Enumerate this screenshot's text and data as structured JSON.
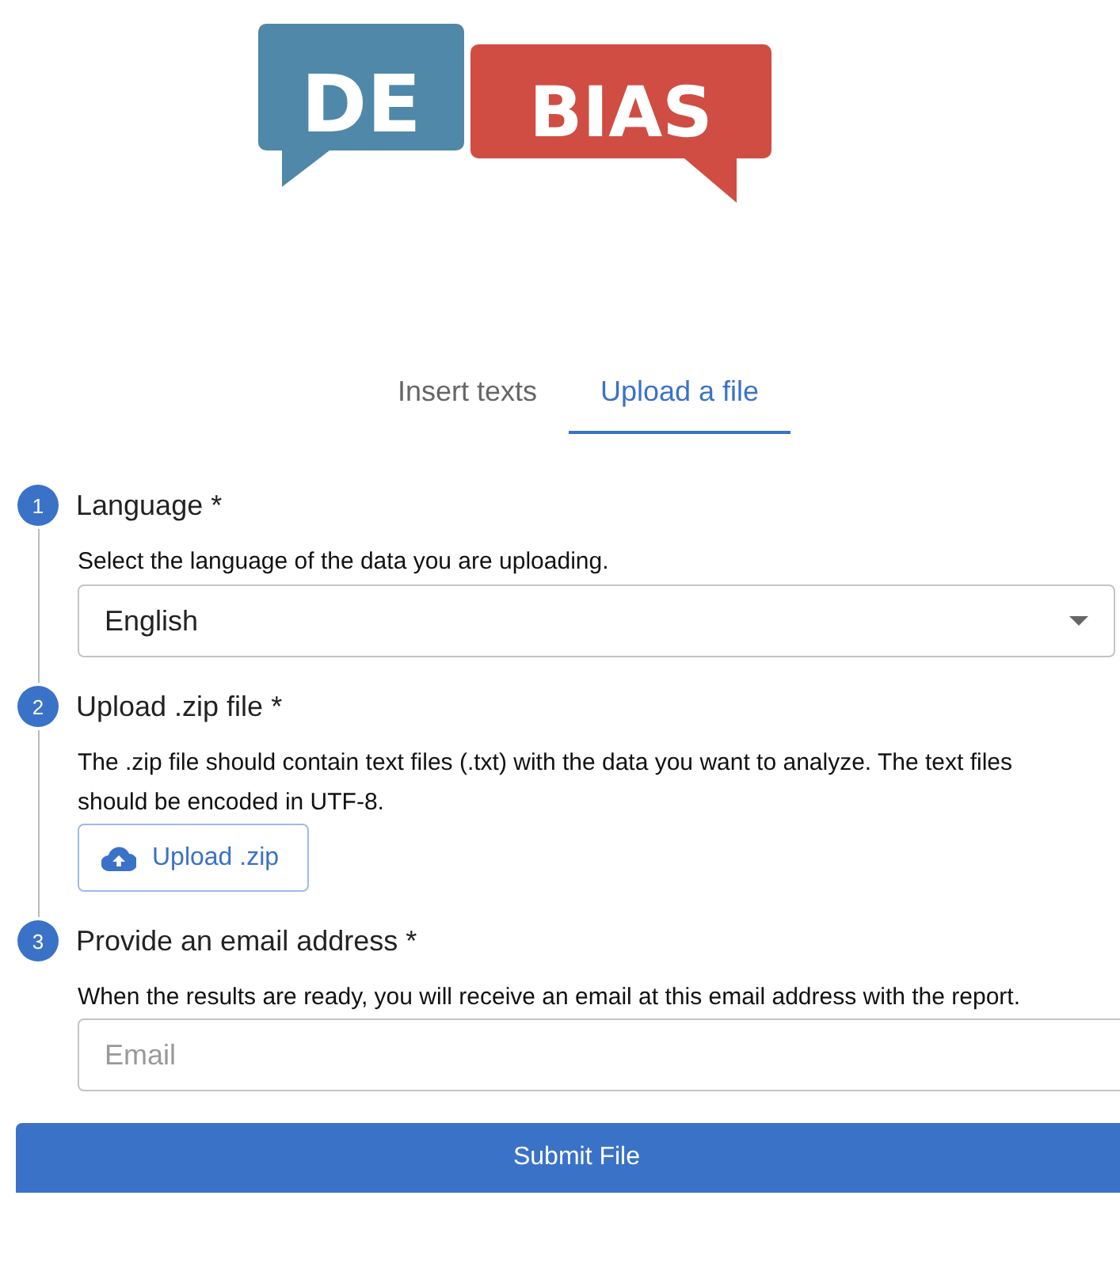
{
  "logo": {
    "words": [
      "DE",
      "BIAS"
    ]
  },
  "tabs": [
    {
      "label": "Insert texts",
      "selected": false
    },
    {
      "label": "Upload a file",
      "selected": true
    }
  ],
  "steps": [
    {
      "number": "1",
      "title": "Language *",
      "description": "Select the language of the data you are uploading.",
      "control": {
        "kind": "select",
        "value": "English"
      }
    },
    {
      "number": "2",
      "title": "Upload .zip file *",
      "description": "The .zip file should contain text files (.txt) with the data you want to analyze. The text files should be encoded in UTF-8.",
      "control": {
        "kind": "upload",
        "label": "Upload .zip"
      }
    },
    {
      "number": "3",
      "title": "Provide an email address *",
      "description": "When the results are ready, you will receive an email at this email address with the report.",
      "control": {
        "kind": "input",
        "placeholder": "Email"
      }
    }
  ],
  "submit": {
    "label": "Submit File"
  }
}
